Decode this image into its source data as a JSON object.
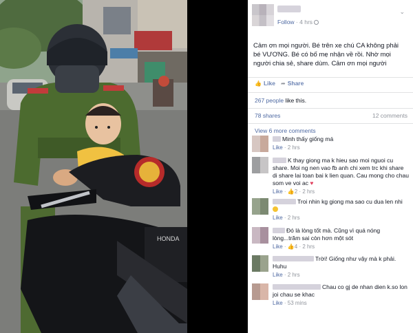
{
  "post": {
    "follow_label": "Follow",
    "separator": " · ",
    "time": "4 hrs",
    "text": "Cảm ơn mọi người. Bé trên xe chú CA không phải bé VƯƠNG. Bé có bố mẹ nhận về rồi. Nhờ mọi người chia sẻ, share dùm. Cảm ơn mọi người",
    "like_label": "Like",
    "share_label": "Share",
    "likes_count": "267 people",
    "likes_suffix": " like this.",
    "shares_label": "78 shares",
    "comments_label": "12 comments",
    "view_more_label": "View 6 more comments"
  },
  "comments": [
    {
      "text": "Minh thấy giống má",
      "like_label": "Like",
      "time": "2 hrs",
      "reactions": ""
    },
    {
      "text": "K thay giong ma k hieu sao moi nguoi cu share. Moi ng nen vao fb anh chi xem trc khi share di share lai toan bai k lien quan. Cau mong cho chau som ve voi ac",
      "like_label": "Like",
      "time": "2 hrs",
      "reactions": "2"
    },
    {
      "text": "Troi nhin kg giong ma sao cu dua len nhi",
      "like_label": "Like",
      "time": "2 hrs",
      "reactions": ""
    },
    {
      "text": "Đó là lòng tốt mà. Cũng vì quá nóng lòng...trăm sai còn hơn một sót",
      "like_label": "Like",
      "time": "2 hrs",
      "reactions": "4"
    },
    {
      "text": "Trời! Giống như vậy mà k phải. Huhu",
      "like_label": "Like",
      "time": "2 hrs",
      "reactions": ""
    },
    {
      "text": "Chau co gj de nhan dien k.so lon joi chau se khac",
      "like_label": "Like",
      "time": "53 mins",
      "reactions": ""
    }
  ],
  "colors": {
    "link": "#4e69a2",
    "muted": "#90949c"
  }
}
